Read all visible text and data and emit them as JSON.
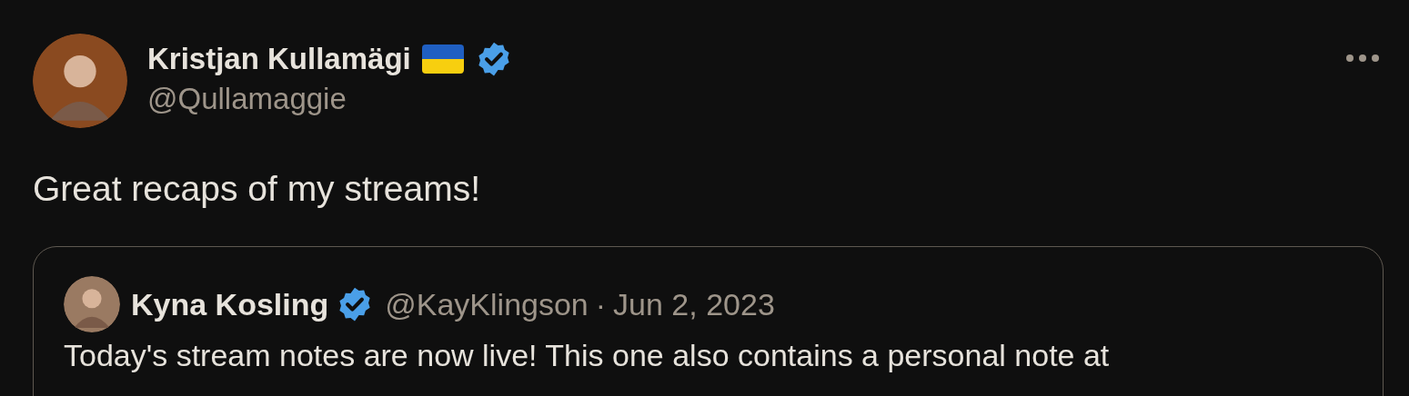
{
  "tweet": {
    "author": {
      "name": "Kristjan Kullamägi",
      "handle": "@Qullamaggie",
      "verified": true
    },
    "text": "Great recaps of my streams!",
    "quoted": {
      "author": {
        "name": "Kyna Kosling",
        "handle": "@KayKlingson",
        "verified": true
      },
      "separator": "·",
      "date": "Jun 2, 2023",
      "text": "Today's stream notes are now live! This one also contains a personal note at"
    }
  }
}
